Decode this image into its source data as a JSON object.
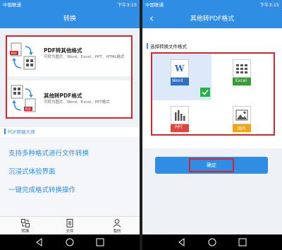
{
  "left": {
    "status": {
      "carrier": "中国联通",
      "time": "下午3:15"
    },
    "title": "转换",
    "pdf_to_other": {
      "title": "PDF转其他格式",
      "desc": "可转为图片、Word、Excel、PPT、HTML格式"
    },
    "other_to_pdf": {
      "title": "其他转PDF格式",
      "desc": "可转为图片、Word、Excel、PPT格式"
    },
    "section_title": "PDF转换大师",
    "features": [
      "支持多种格式进行文件转换",
      "沉浸式体验界面",
      "一键完成格式转换操作"
    ],
    "tabs": [
      {
        "label": "转换",
        "icon": "convert-icon"
      },
      {
        "label": "文件",
        "icon": "file-icon"
      },
      {
        "label": "我的",
        "icon": "person-icon"
      }
    ]
  },
  "right": {
    "status": {
      "carrier": "中国联通",
      "time": "下午3:15"
    },
    "title": "其他转PDF格式",
    "section_title": "选择转换文件格式",
    "formats": [
      {
        "label": "Word",
        "color": "#2e6fc4",
        "icon": "word-icon",
        "selected": true
      },
      {
        "label": "Excel",
        "color": "#3a9a3a",
        "icon": "excel-icon",
        "selected": false
      },
      {
        "label": "PPT",
        "color": "#e2453c",
        "icon": "ppt-icon",
        "selected": false
      },
      {
        "label": "图片",
        "color": "#f2a614",
        "icon": "image-icon",
        "selected": false
      }
    ],
    "confirm_label": "确定"
  },
  "colors": {
    "primary": "#2f8de4",
    "highlight": "#d9232e",
    "check": "#2ab04a"
  }
}
